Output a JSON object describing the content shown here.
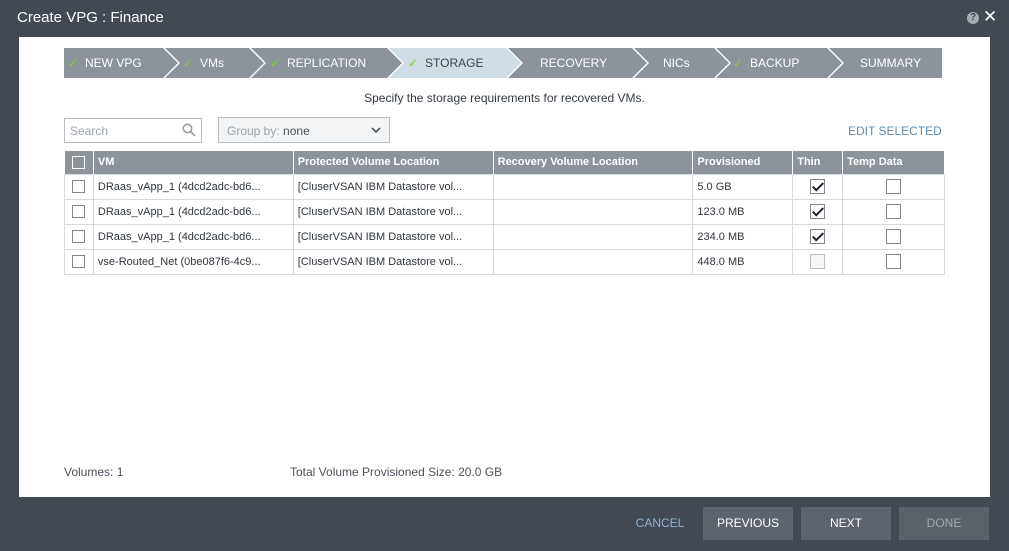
{
  "window": {
    "title": "Create VPG : Finance",
    "help_icon": "help-icon",
    "close_icon": "close-icon",
    "help_glyph": "?",
    "close_glyph": "✕"
  },
  "wizard": {
    "check_glyph": "✓",
    "steps": [
      {
        "label": "NEW VPG",
        "done": true,
        "active": false
      },
      {
        "label": "VMs",
        "done": true,
        "active": false
      },
      {
        "label": "REPLICATION",
        "done": true,
        "active": false
      },
      {
        "label": "STORAGE",
        "done": true,
        "active": true
      },
      {
        "label": "RECOVERY",
        "done": false,
        "active": false
      },
      {
        "label": "NICs",
        "done": false,
        "active": false
      },
      {
        "label": "BACKUP",
        "done": true,
        "active": false
      },
      {
        "label": "SUMMARY",
        "done": false,
        "active": false
      }
    ]
  },
  "instruction": "Specify the storage requirements for recovered VMs.",
  "search": {
    "placeholder": "Search"
  },
  "group_by": {
    "label": "Group by:",
    "value": "none"
  },
  "edit_selected": "EDIT SELECTED",
  "table": {
    "columns": [
      "VM",
      "Protected Volume Location",
      "Recovery Volume Location",
      "Provisioned",
      "Thin",
      "Temp Data"
    ],
    "rows": [
      {
        "vm": "DRaas_vApp_1 (4dcd2adc-bd6...",
        "protected": "[CluserVSAN IBM Datastore vol...",
        "recovery": "",
        "provisioned": "5.0 GB",
        "thin": true,
        "thin_enabled": true,
        "temp": false
      },
      {
        "vm": "DRaas_vApp_1 (4dcd2adc-bd6...",
        "protected": "[CluserVSAN IBM Datastore vol...",
        "recovery": "",
        "provisioned": "123.0 MB",
        "thin": true,
        "thin_enabled": true,
        "temp": false
      },
      {
        "vm": "DRaas_vApp_1 (4dcd2adc-bd6...",
        "protected": "[CluserVSAN IBM Datastore vol...",
        "recovery": "",
        "provisioned": "234.0 MB",
        "thin": true,
        "thin_enabled": true,
        "temp": false
      },
      {
        "vm": "vse-Routed_Net (0be087f6-4c9...",
        "protected": "[CluserVSAN IBM Datastore vol...",
        "recovery": "",
        "provisioned": "448.0 MB",
        "thin": false,
        "thin_enabled": false,
        "temp": false
      }
    ]
  },
  "footer": {
    "volumes": "Volumes: 1",
    "total": "Total Volume Provisioned Size: 20.0 GB"
  },
  "buttons": {
    "cancel": "CANCEL",
    "previous": "PREVIOUS",
    "next": "NEXT",
    "done": "DONE"
  }
}
